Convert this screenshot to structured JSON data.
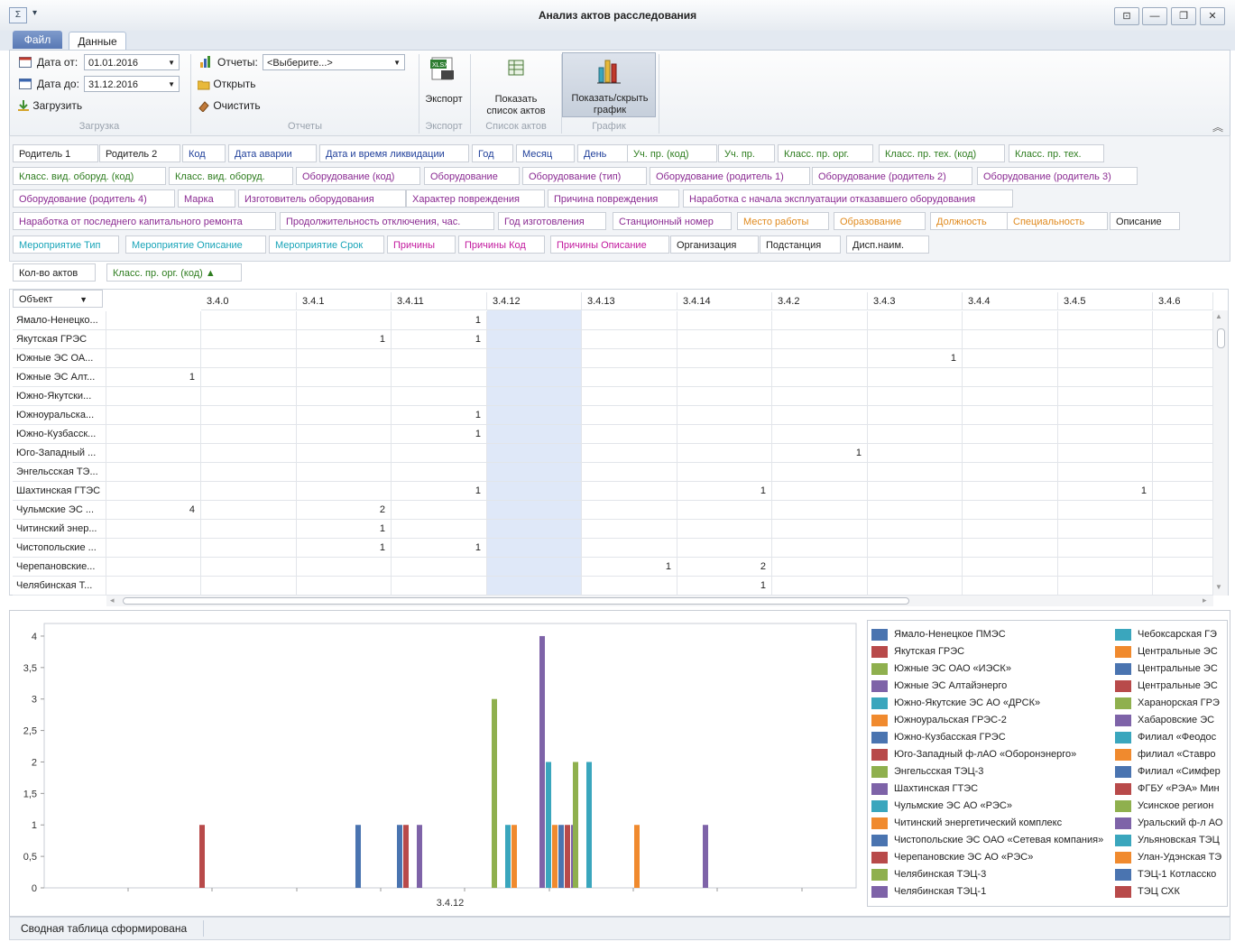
{
  "window": {
    "title": "Анализ актов расследования"
  },
  "tabs": {
    "file": "Файл",
    "data": "Данные"
  },
  "ribbon": {
    "load": {
      "date_from_label": "Дата от:",
      "date_from_value": "01.01.2016",
      "date_to_label": "Дата до:",
      "date_to_value": "31.12.2016",
      "load_button": "Загрузить",
      "group_label": "Загрузка"
    },
    "reports": {
      "reports_label": "Отчеты:",
      "reports_value": "<Выберите...>",
      "open_button": "Открыть",
      "clear_button": "Очистить",
      "group_label": "Отчеты"
    },
    "export": {
      "button": "Экспорт",
      "group_label": "Экспорт"
    },
    "list": {
      "button_line1": "Показать",
      "button_line2": "список актов",
      "group_label": "Список актов"
    },
    "chart": {
      "button_line1": "Показать/скрыть",
      "button_line2": "график",
      "group_label": "График"
    }
  },
  "fields": [
    {
      "label": "Родитель 1",
      "color": "#222222"
    },
    {
      "label": "Родитель 2",
      "color": "#222222"
    },
    {
      "label": "Код",
      "color": "#1f3f9a"
    },
    {
      "label": "Дата аварии",
      "color": "#1f3f9a"
    },
    {
      "label": "Дата и время ликвидации",
      "color": "#1f3f9a"
    },
    {
      "label": "Год",
      "color": "#1f3f9a"
    },
    {
      "label": "Месяц",
      "color": "#1f3f9a"
    },
    {
      "label": "День",
      "color": "#1f3f9a"
    },
    {
      "label": "Уч. пр. (код)",
      "color": "#2e7d1f"
    },
    {
      "label": "Уч. пр.",
      "color": "#2e7d1f"
    },
    {
      "label": "Класс. пр. орг.",
      "color": "#2e7d1f"
    },
    {
      "label": "Класс. пр. тех. (код)",
      "color": "#2e7d1f"
    },
    {
      "label": "Класс. пр. тех.",
      "color": "#2e7d1f"
    },
    {
      "label": "Класс. вид. оборуд. (код)",
      "color": "#2e7d1f"
    },
    {
      "label": "Класс. вид. оборуд.",
      "color": "#2e7d1f"
    },
    {
      "label": "Оборудование (код)",
      "color": "#8a2a92"
    },
    {
      "label": "Оборудование",
      "color": "#8a2a92"
    },
    {
      "label": "Оборудование (тип)",
      "color": "#8a2a92"
    },
    {
      "label": "Оборудование (родитель 1)",
      "color": "#8a2a92"
    },
    {
      "label": "Оборудование (родитель 2)",
      "color": "#8a2a92"
    },
    {
      "label": "Оборудование (родитель 3)",
      "color": "#8a2a92"
    },
    {
      "label": "Оборудование (родитель 4)",
      "color": "#8a2a92"
    },
    {
      "label": "Марка",
      "color": "#8a2a92"
    },
    {
      "label": "Изготовитель оборудования",
      "color": "#8a2a92"
    },
    {
      "label": "Характер повреждения",
      "color": "#8a2a92"
    },
    {
      "label": "Причина повреждения",
      "color": "#8a2a92"
    },
    {
      "label": "Наработка с начала эксплуатации отказавшего оборудования",
      "color": "#8a2a92"
    },
    {
      "label": "Наработка от последнего капитального ремонта",
      "color": "#8a2a92"
    },
    {
      "label": "Продолжительность отключения, час.",
      "color": "#8a2a92"
    },
    {
      "label": "Год изготовления",
      "color": "#8a2a92"
    },
    {
      "label": "Станционный номер",
      "color": "#8a2a92"
    },
    {
      "label": "Место работы",
      "color": "#e08a1e"
    },
    {
      "label": "Образование",
      "color": "#e08a1e"
    },
    {
      "label": "Должность",
      "color": "#e08a1e"
    },
    {
      "label": "Специальность",
      "color": "#e08a1e"
    },
    {
      "label": "Описание",
      "color": "#222222"
    },
    {
      "label": "Мероприятие Тип",
      "color": "#18a4b8"
    },
    {
      "label": "Мероприятие Описание",
      "color": "#18a4b8"
    },
    {
      "label": "Мероприятие Срок",
      "color": "#18a4b8"
    },
    {
      "label": "Причины",
      "color": "#c2199e"
    },
    {
      "label": "Причины Код",
      "color": "#c2199e"
    },
    {
      "label": "Причины Описание",
      "color": "#c2199e"
    },
    {
      "label": "Организация",
      "color": "#222222"
    },
    {
      "label": "Подстанция",
      "color": "#222222"
    },
    {
      "label": "Дисп.наим.",
      "color": "#222222"
    }
  ],
  "data_area": {
    "measure": "Кол-во актов",
    "column_field": "Класс. пр. орг. (код)",
    "column_sort": "▲"
  },
  "row_field": {
    "label": "Объект",
    "arrow": "▼"
  },
  "grid": {
    "columns": [
      "",
      "3.4.0",
      "3.4.1",
      "3.4.11",
      "3.4.12",
      "3.4.13",
      "3.4.14",
      "3.4.2",
      "3.4.3",
      "3.4.4",
      "3.4.5",
      "3.4.6"
    ],
    "rows": [
      {
        "label": "Ямало-Ненецко...",
        "cells": [
          "",
          "",
          "",
          "1",
          "",
          "",
          "",
          "",
          "",
          "",
          "",
          ""
        ]
      },
      {
        "label": "Якутская ГРЭС",
        "cells": [
          "",
          "",
          "1",
          "1",
          "",
          "",
          "",
          "",
          "",
          "",
          "",
          ""
        ]
      },
      {
        "label": "Южные ЭС ОА...",
        "cells": [
          "",
          "",
          "",
          "",
          "",
          "",
          "",
          "",
          "1",
          "",
          "",
          ""
        ]
      },
      {
        "label": "Южные ЭС Алт...",
        "cells": [
          "1",
          "",
          "",
          "",
          "",
          "",
          "",
          "",
          "",
          "",
          "",
          ""
        ]
      },
      {
        "label": "Южно-Якутски...",
        "cells": [
          "",
          "",
          "",
          "",
          "",
          "",
          "",
          "",
          "",
          "",
          "",
          ""
        ]
      },
      {
        "label": "Южноуральска...",
        "cells": [
          "",
          "",
          "",
          "1",
          "",
          "",
          "",
          "",
          "",
          "",
          "",
          ""
        ]
      },
      {
        "label": "Южно-Кузбасск...",
        "cells": [
          "",
          "",
          "",
          "1",
          "",
          "",
          "",
          "",
          "",
          "",
          "",
          ""
        ]
      },
      {
        "label": "Юго-Западный ...",
        "cells": [
          "",
          "",
          "",
          "",
          "",
          "",
          "",
          "1",
          "",
          "",
          "",
          ""
        ]
      },
      {
        "label": "Энгельсская ТЭ...",
        "cells": [
          "",
          "",
          "",
          "",
          "",
          "",
          "",
          "",
          "",
          "",
          "",
          ""
        ]
      },
      {
        "label": "Шахтинская ГТЭС",
        "cells": [
          "",
          "",
          "",
          "1",
          "",
          "",
          "1",
          "",
          "",
          "",
          "1",
          ""
        ]
      },
      {
        "label": "Чульмские ЭС ...",
        "cells": [
          "4",
          "",
          "2",
          "",
          "",
          "",
          "",
          "",
          "",
          "",
          "",
          ""
        ]
      },
      {
        "label": "Читинский энер...",
        "cells": [
          "",
          "",
          "1",
          "",
          "",
          "",
          "",
          "",
          "",
          "",
          "",
          ""
        ]
      },
      {
        "label": "Чистопольские ...",
        "cells": [
          "",
          "",
          "1",
          "1",
          "",
          "",
          "",
          "",
          "",
          "",
          "",
          ""
        ]
      },
      {
        "label": "Черепановские...",
        "cells": [
          "",
          "",
          "",
          "",
          "",
          "1",
          "2",
          "",
          "",
          "",
          "",
          ""
        ]
      },
      {
        "label": "Челябинская Т...",
        "cells": [
          "",
          "",
          "",
          "",
          "",
          "",
          "1",
          "",
          "",
          "",
          "",
          ""
        ]
      }
    ]
  },
  "chart_data": {
    "type": "bar",
    "categories": [
      "3.4.12"
    ],
    "ylim": [
      0,
      4.2
    ],
    "yticks": [
      "0",
      "0,5",
      "1",
      "1,5",
      "2",
      "2,5",
      "3",
      "3,5",
      "4"
    ],
    "values": [
      1,
      1,
      1,
      1,
      1,
      3,
      1,
      1,
      4,
      2,
      1,
      1,
      1,
      1,
      2,
      2,
      1,
      1
    ],
    "bar_colors": [
      "#b84a4a",
      "#4a74b0",
      "#4a74b0",
      "#b84a4a",
      "#7e63a8",
      "#8fb04e",
      "#3aa6bd",
      "#f08a2e",
      "#7e63a8",
      "#3aa6bd",
      "#f08a2e",
      "#4a74b0",
      "#b84a4a",
      "#7e63a8",
      "#8fb04e",
      "#3aa6bd",
      "#f08a2e",
      "#7e63a8"
    ],
    "legend_col1": [
      {
        "name": "Ямало-Ненецкое ПМЭС",
        "color": "#4a74b0"
      },
      {
        "name": "Якутская ГРЭС",
        "color": "#b84a4a"
      },
      {
        "name": "Южные ЭС ОАО «ИЭСК»",
        "color": "#8fb04e"
      },
      {
        "name": "Южные ЭС Алтайэнерго",
        "color": "#7e63a8"
      },
      {
        "name": "Южно-Якутские ЭС АО «ДРСК»",
        "color": "#3aa6bd"
      },
      {
        "name": "Южноуральская ГРЭС-2",
        "color": "#f08a2e"
      },
      {
        "name": "Южно-Кузбасская ГРЭС",
        "color": "#4a74b0"
      },
      {
        "name": "Юго-Западный ф-лАО «Оборонэнерго»",
        "color": "#b84a4a"
      },
      {
        "name": "Энгельсская ТЭЦ-3",
        "color": "#8fb04e"
      },
      {
        "name": "Шахтинская ГТЭС",
        "color": "#7e63a8"
      },
      {
        "name": "Чульмские ЭС АО «РЭС»",
        "color": "#3aa6bd"
      },
      {
        "name": "Читинский энергетический комплекс",
        "color": "#f08a2e"
      },
      {
        "name": "Чистопольские ЭС ОАО «Сетевая компания»",
        "color": "#4a74b0"
      },
      {
        "name": "Черепановские ЭС АО «РЭС»",
        "color": "#b84a4a"
      },
      {
        "name": "Челябинская ТЭЦ-3",
        "color": "#8fb04e"
      },
      {
        "name": "Челябинская ТЭЦ-1",
        "color": "#7e63a8"
      }
    ],
    "legend_col2": [
      {
        "name": "Чебоксарская ГЭ",
        "color": "#3aa6bd"
      },
      {
        "name": "Центральные ЭС",
        "color": "#f08a2e"
      },
      {
        "name": "Центральные ЭС",
        "color": "#4a74b0"
      },
      {
        "name": "Центральные ЭС",
        "color": "#b84a4a"
      },
      {
        "name": "Харанорская ГРЭ",
        "color": "#8fb04e"
      },
      {
        "name": "Хабаровские ЭС",
        "color": "#7e63a8"
      },
      {
        "name": "Филиал «Феодос",
        "color": "#3aa6bd"
      },
      {
        "name": "филиал «Ставро",
        "color": "#f08a2e"
      },
      {
        "name": "Филиал «Симфер",
        "color": "#4a74b0"
      },
      {
        "name": "ФГБУ «РЭА» Мин",
        "color": "#b84a4a"
      },
      {
        "name": "Усинское регион",
        "color": "#8fb04e"
      },
      {
        "name": "Уральский ф-л АО",
        "color": "#7e63a8"
      },
      {
        "name": "Ульяновская ТЭЦ",
        "color": "#3aa6bd"
      },
      {
        "name": "Улан-Удэнская ТЭ",
        "color": "#f08a2e"
      },
      {
        "name": "ТЭЦ-1 Котласско",
        "color": "#4a74b0"
      },
      {
        "name": "ТЭЦ СХК",
        "color": "#b84a4a"
      }
    ]
  },
  "status": {
    "text": "Сводная таблица сформирована"
  }
}
